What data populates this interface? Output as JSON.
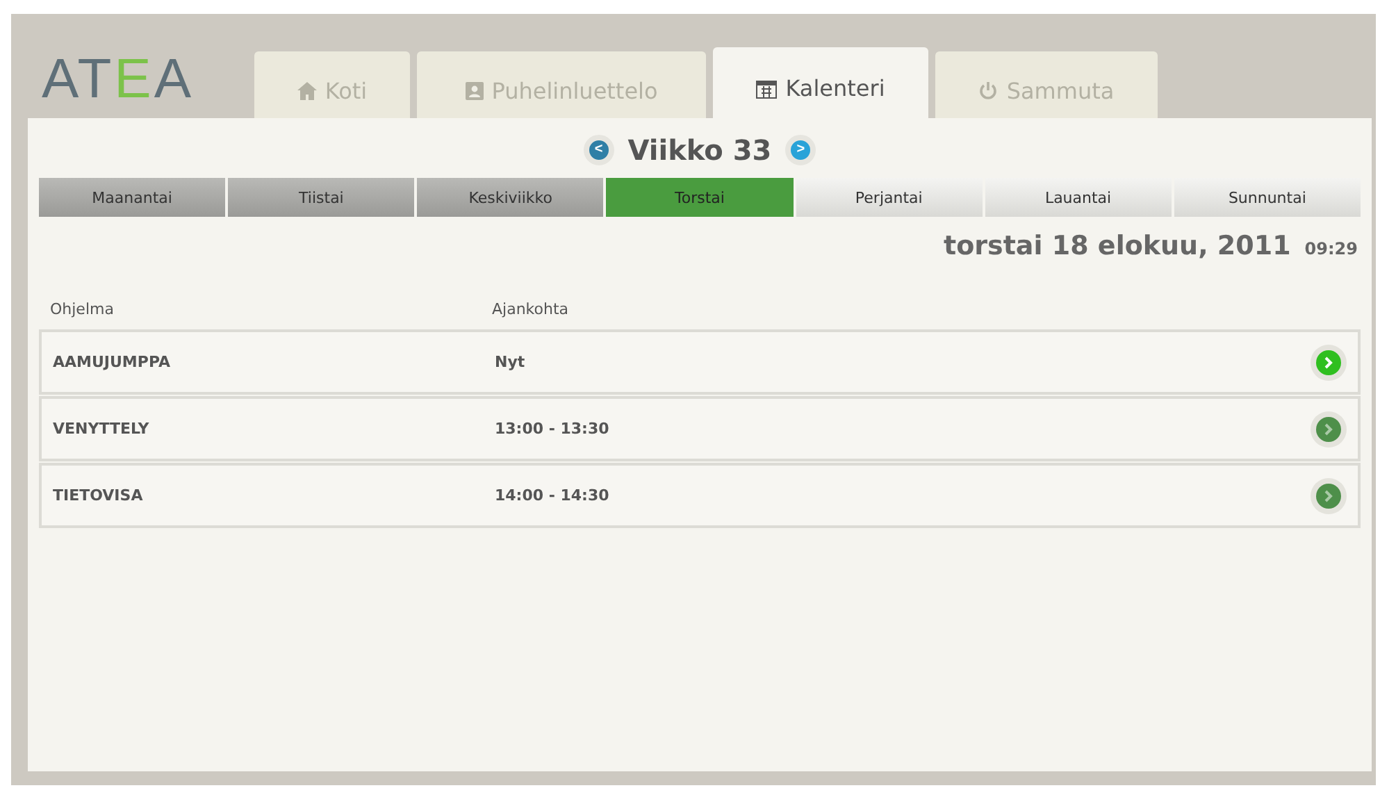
{
  "logo": {
    "text": "ATEA"
  },
  "tabs": [
    {
      "label": "Koti",
      "kind": "home",
      "selected": false
    },
    {
      "label": "Puhelinluettelo",
      "kind": "contacts",
      "selected": false
    },
    {
      "label": "Kalenteri",
      "kind": "calendar",
      "selected": true
    },
    {
      "label": "Sammuta",
      "kind": "power",
      "selected": false
    }
  ],
  "week": {
    "title": "Viikko 33",
    "prev": "<",
    "next": ">"
  },
  "days": [
    {
      "label": "Maanantai",
      "selected": false
    },
    {
      "label": "Tiistai",
      "selected": false
    },
    {
      "label": "Keskiviikko",
      "selected": false
    },
    {
      "label": "Torstai",
      "selected": true
    },
    {
      "label": "Perjantai",
      "selected": false
    },
    {
      "label": "Lauantai",
      "selected": false
    },
    {
      "label": "Sunnuntai",
      "selected": false
    }
  ],
  "date": "torstai 18 elokuu, 2011",
  "time": "09:29",
  "table": {
    "columns": [
      "Ohjelma",
      "Ajankohta"
    ],
    "rows": [
      {
        "program": "AAMUJUMPPA",
        "time": "Nyt",
        "active": true
      },
      {
        "program": "VENYTTELY",
        "time": "13:00 - 13:30",
        "active": false
      },
      {
        "program": "TIETOVISA",
        "time": "14:00 - 14:30",
        "active": false
      }
    ]
  }
}
